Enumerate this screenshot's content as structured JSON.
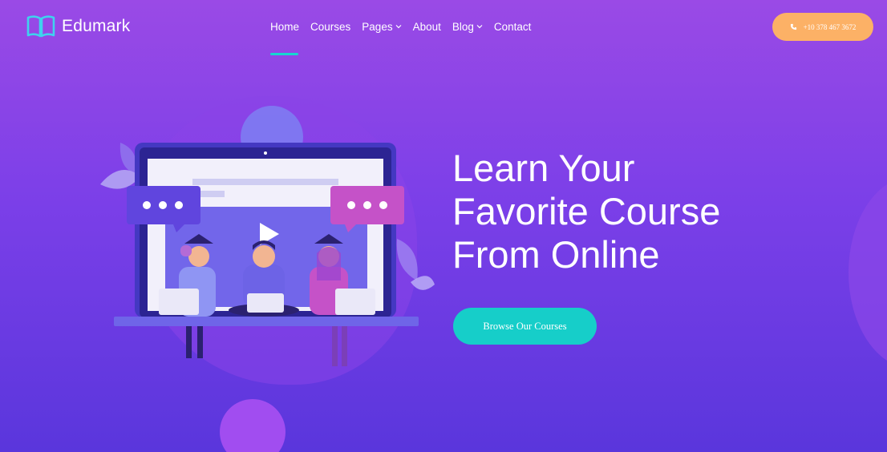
{
  "brand": {
    "name": "Edumark",
    "icon": "open-book-icon",
    "accent": "#16d7cf"
  },
  "nav": {
    "items": [
      {
        "label": "Home",
        "active": true
      },
      {
        "label": "Courses"
      },
      {
        "label": "Pages",
        "has_dropdown": true
      },
      {
        "label": "About"
      },
      {
        "label": "Blog",
        "has_dropdown": true
      },
      {
        "label": "Contact"
      }
    ]
  },
  "header": {
    "phone": {
      "label": "+10 378 467 3672",
      "icon": "phone-icon",
      "color": "#fcb166"
    }
  },
  "hero": {
    "title_lines": [
      "Learn Your",
      "Favorite Course",
      "From Online"
    ],
    "cta": {
      "label": "Browse Our Courses",
      "color": "#16cec9"
    },
    "illustration": "online-learning-illustration"
  },
  "colors": {
    "bg_top": "#9a4ae6",
    "bg_bottom": "#5a36dc"
  }
}
